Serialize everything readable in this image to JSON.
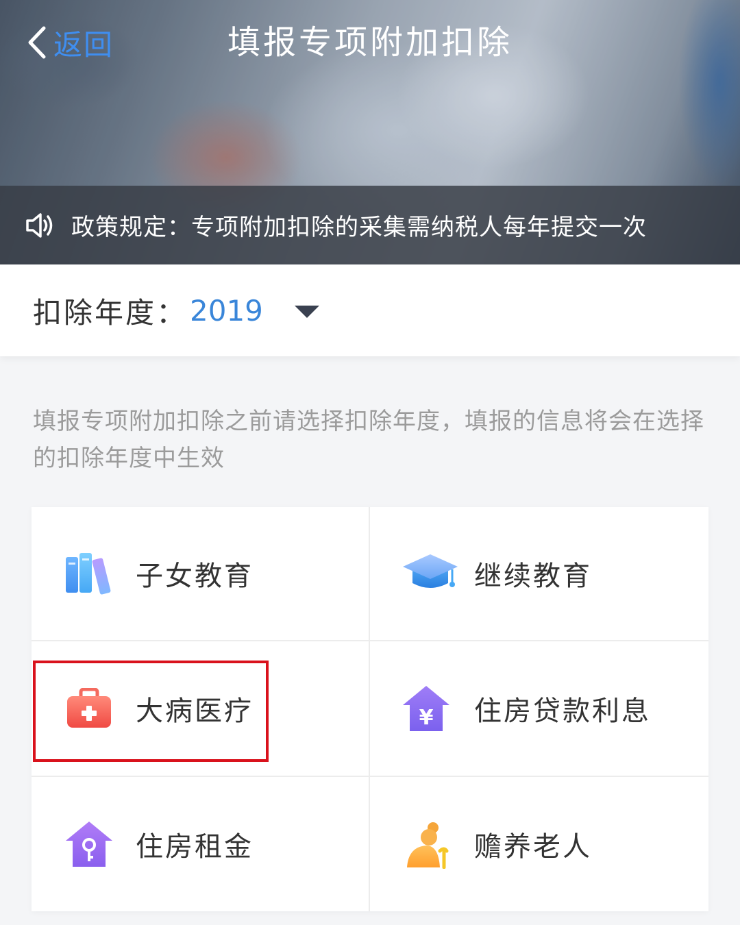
{
  "header": {
    "back_label": "返回",
    "title": "填报专项附加扣除",
    "notice": "政策规定：专项附加扣除的采集需纳税人每年提交一次"
  },
  "year_selector": {
    "label": "扣除年度：",
    "value": "2019"
  },
  "hint": "填报专项附加扣除之前请选择扣除年度，填报的信息将会在选择的扣除年度中生效",
  "categories": [
    {
      "label": "子女教育",
      "icon": "books-icon"
    },
    {
      "label": "继续教育",
      "icon": "graduation-cap-icon"
    },
    {
      "label": "大病医疗",
      "icon": "medical-kit-icon"
    },
    {
      "label": "住房贷款利息",
      "icon": "house-yuan-icon"
    },
    {
      "label": "住房租金",
      "icon": "house-key-icon"
    },
    {
      "label": "赡养老人",
      "icon": "elderly-person-icon"
    }
  ],
  "highlighted_item": "大病医疗",
  "colors": {
    "accent_blue": "#3a86d9",
    "highlight_red": "#d9121c"
  }
}
